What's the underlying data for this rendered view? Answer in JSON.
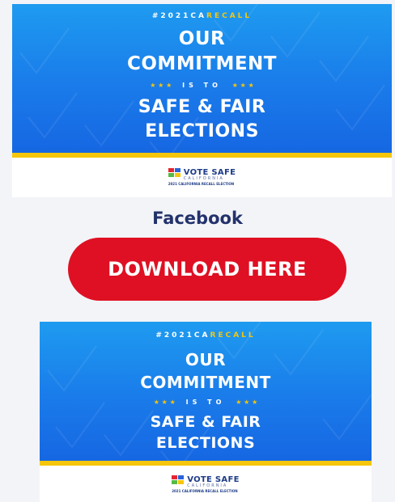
{
  "banner": {
    "hashtag_main": "#2021CA",
    "hashtag_highlight": "RECALL",
    "line1": "OUR",
    "line2": "COMMITMENT",
    "stars_left": "★ ★ ★",
    "is_to": "IS TO",
    "stars_right": "★ ★ ★",
    "line3": "SAFE & FAIR",
    "line4": "ELECTIONS",
    "logo_title": "VOTE SAFE",
    "logo_state": "CALIFORNIA",
    "logo_subtitle": "2021 CALIFORNIA RECALL ELECTION"
  },
  "section": {
    "platform_label": "Facebook",
    "download_label": "DOWNLOAD HERE"
  },
  "colors": {
    "banner_blue": "#1a7bea",
    "accent_yellow": "#f6c60b",
    "button_red": "#df1023",
    "label_navy": "#23326b",
    "logo_squares": [
      "#e3262f",
      "#2a63d8",
      "#57b947",
      "#f6c60b"
    ]
  }
}
